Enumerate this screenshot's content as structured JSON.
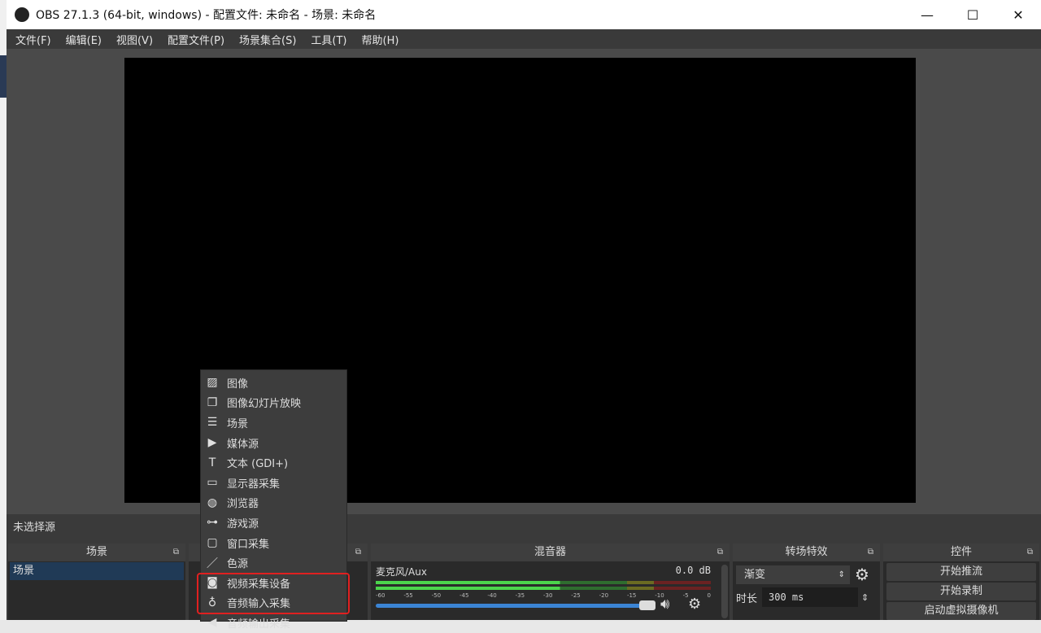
{
  "window": {
    "title": "OBS 27.1.3 (64-bit, windows) - 配置文件: 未命名 - 场景: 未命名",
    "minimize": "—",
    "maximize": "☐",
    "close": "✕"
  },
  "menu": [
    "文件(F)",
    "编辑(E)",
    "视图(V)",
    "配置文件(P)",
    "场景集合(S)",
    "工具(T)",
    "帮助(H)"
  ],
  "source_status": "未选择源",
  "scenes": {
    "title": "场景",
    "items": [
      "场景"
    ]
  },
  "mixer": {
    "title": "混音器",
    "channel": "麦克风/Aux",
    "level": "0.0 dB",
    "ticks": [
      "-60",
      "-55",
      "-50",
      "-45",
      "-40",
      "-35",
      "-30",
      "-25",
      "-20",
      "-15",
      "-10",
      "-5",
      "0"
    ],
    "volume": 0.95
  },
  "transitions": {
    "title": "转场特效",
    "selected": "渐变",
    "duration_label": "时长",
    "duration": "300 ms"
  },
  "controls": {
    "title": "控件",
    "buttons": [
      "开始推流",
      "开始录制",
      "启动虚拟摄像机"
    ]
  },
  "context_menu": [
    {
      "icon": "image-icon",
      "glyph": "▨",
      "label": "图像"
    },
    {
      "icon": "slideshow-icon",
      "glyph": "❐",
      "label": "图像幻灯片放映"
    },
    {
      "icon": "list-icon",
      "glyph": "☰",
      "label": "场景"
    },
    {
      "icon": "play-icon",
      "glyph": "▶",
      "label": "媒体源"
    },
    {
      "icon": "text-icon",
      "glyph": "T",
      "label": "文本 (GDI+)"
    },
    {
      "icon": "monitor-icon",
      "glyph": "▭",
      "label": "显示器采集"
    },
    {
      "icon": "globe-icon",
      "glyph": "◍",
      "label": "浏览器"
    },
    {
      "icon": "gamepad-icon",
      "glyph": "⊶",
      "label": "游戏源"
    },
    {
      "icon": "window-icon",
      "glyph": "▢",
      "label": "窗口采集"
    },
    {
      "icon": "brush-icon",
      "glyph": "／",
      "label": "色源"
    },
    {
      "icon": "camera-icon",
      "glyph": "◙",
      "label": "视频采集设备"
    },
    {
      "icon": "microphone-icon",
      "glyph": "♁",
      "label": "音频输入采集"
    },
    {
      "icon": "speaker-icon",
      "glyph": "◀",
      "label": "音频输出采集"
    }
  ]
}
